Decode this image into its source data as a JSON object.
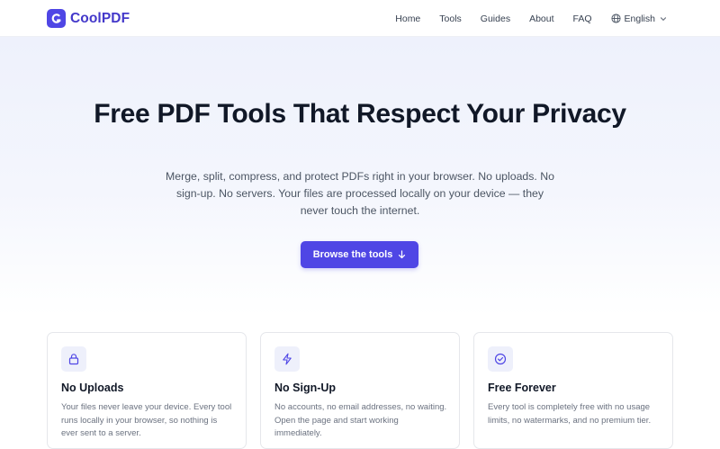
{
  "brand": {
    "name": "CoolPDF",
    "accent": "#4f46e5"
  },
  "nav": {
    "links": [
      "Home",
      "Tools",
      "Guides",
      "About",
      "FAQ"
    ],
    "language": "English"
  },
  "hero": {
    "title": "Free PDF Tools That Respect Your Privacy",
    "subtitle": "Merge, split, compress, and protect PDFs right in your browser. No uploads. No sign-up. No servers. Your files are processed locally on your device — they never touch the internet.",
    "cta_label": "Browse the tools"
  },
  "features": [
    {
      "icon": "lock-icon",
      "title": "No Uploads",
      "description": "Your files never leave your device. Every tool runs locally in your browser, so nothing is ever sent to a server."
    },
    {
      "icon": "lightning-icon",
      "title": "No Sign-Up",
      "description": "No accounts, no email addresses, no waiting. Open the page and start working immediately."
    },
    {
      "icon": "check-circle-icon",
      "title": "Free Forever",
      "description": "Every tool is completely free with no usage limits, no watermarks, and no premium tier."
    }
  ]
}
